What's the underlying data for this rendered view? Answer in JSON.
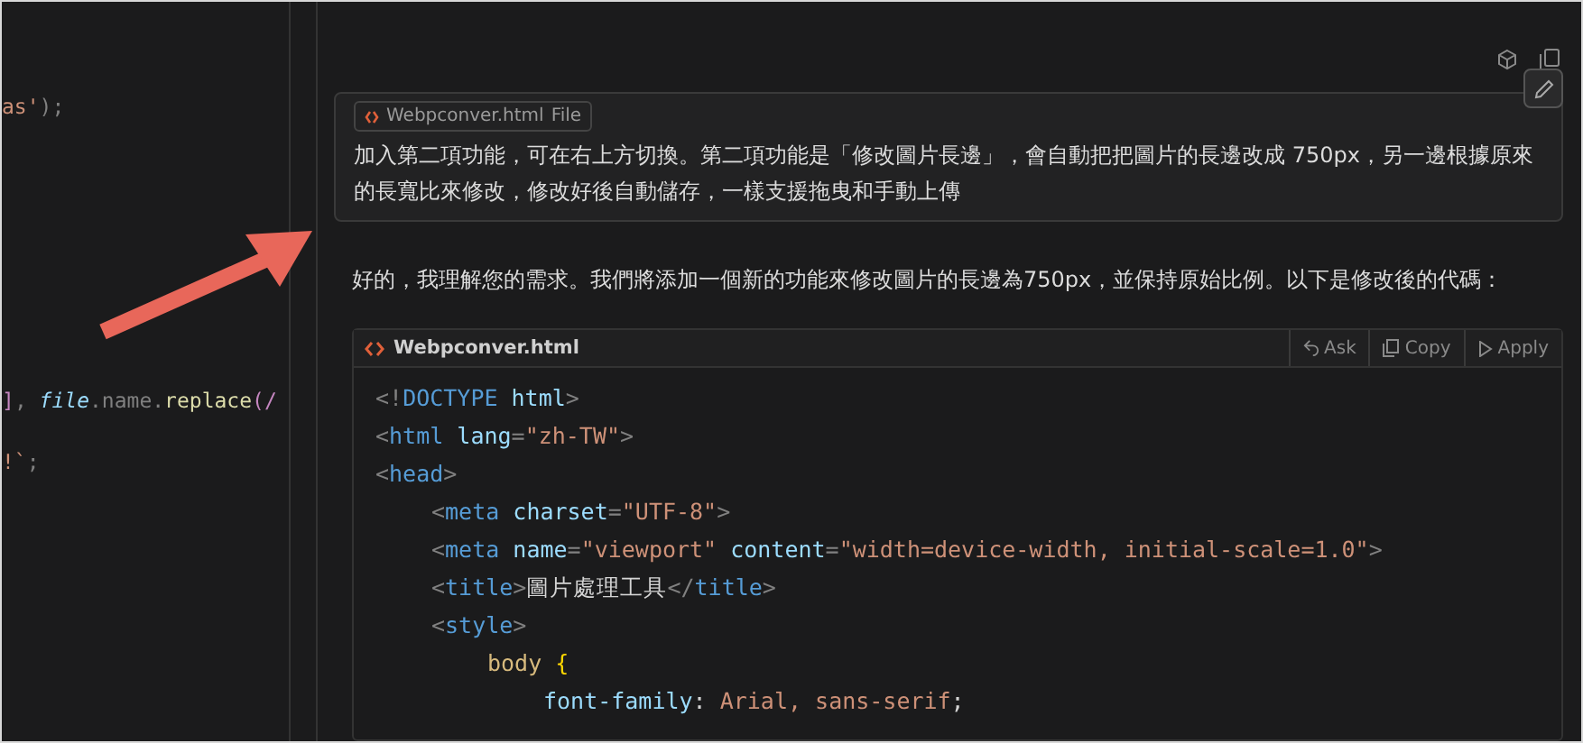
{
  "editor": {
    "lines": [
      {
        "segments": [
          {
            "kind": "string",
            "text": "as'"
          },
          {
            "kind": "punct",
            "text": ");"
          }
        ]
      },
      {
        "segments": [
          {
            "kind": "keyword",
            "text": "]"
          },
          {
            "kind": "punct",
            "text": ", "
          },
          {
            "kind": "italic",
            "text": "file"
          },
          {
            "kind": "punct",
            "text": ".name."
          },
          {
            "kind": "fn",
            "text": "replace"
          },
          {
            "kind": "keyword",
            "text": "(/"
          }
        ]
      },
      {
        "segments": [
          {
            "kind": "string",
            "text": "!`"
          },
          {
            "kind": "punct",
            "text": ";"
          }
        ]
      }
    ]
  },
  "chat": {
    "user_message": {
      "attachment": {
        "name": "Webpconver.html",
        "type": "File"
      },
      "text": "加入第二項功能，可在右上方切換。第二項功能是「修改圖片長邊」，會自動把把圖片的長邊改成 750px，另一邊根據原來的長寬比來修改，修改好後自動儲存，一樣支援拖曳和手動上傳"
    },
    "reply_text": "好的，我理解您的需求。我們將添加一個新的功能來修改圖片的長邊為750px，並保持原始比例。以下是修改後的代碼：",
    "code_block": {
      "filename": "Webpconver.html",
      "actions": [
        {
          "kind": "ask",
          "label": "Ask"
        },
        {
          "kind": "copy",
          "label": "Copy"
        },
        {
          "kind": "apply",
          "label": "Apply"
        }
      ],
      "lines": [
        {
          "segments": [
            {
              "kind": "punct",
              "text": "<!"
            },
            {
              "kind": "tag",
              "text": "DOCTYPE"
            },
            {
              "kind": "attr",
              "text": " html"
            },
            {
              "kind": "punct",
              "text": ">"
            }
          ]
        },
        {
          "segments": [
            {
              "kind": "punct",
              "text": "<"
            },
            {
              "kind": "tag",
              "text": "html"
            },
            {
              "kind": "attr",
              "text": " lang"
            },
            {
              "kind": "punct",
              "text": "="
            },
            {
              "kind": "string",
              "text": "\"zh-TW\""
            },
            {
              "kind": "punct",
              "text": ">"
            }
          ]
        },
        {
          "segments": [
            {
              "kind": "punct",
              "text": "<"
            },
            {
              "kind": "tag",
              "text": "head"
            },
            {
              "kind": "punct",
              "text": ">"
            }
          ],
          "children": [
            {
              "segments": [
                {
                  "kind": "punct",
                  "text": "<"
                },
                {
                  "kind": "tag",
                  "text": "meta"
                },
                {
                  "kind": "attr",
                  "text": " charset"
                },
                {
                  "kind": "punct",
                  "text": "="
                },
                {
                  "kind": "string",
                  "text": "\"UTF-8\""
                },
                {
                  "kind": "punct",
                  "text": ">"
                }
              ]
            },
            {
              "segments": [
                {
                  "kind": "punct",
                  "text": "<"
                },
                {
                  "kind": "tag",
                  "text": "meta"
                },
                {
                  "kind": "attr",
                  "text": " name"
                },
                {
                  "kind": "punct",
                  "text": "="
                },
                {
                  "kind": "string",
                  "text": "\"viewport\""
                },
                {
                  "kind": "attr",
                  "text": " content"
                },
                {
                  "kind": "punct",
                  "text": "="
                },
                {
                  "kind": "string",
                  "text": "\"width=device-width, initial-scale=1.0\""
                },
                {
                  "kind": "punct",
                  "text": ">"
                }
              ]
            },
            {
              "segments": [
                {
                  "kind": "punct",
                  "text": "<"
                },
                {
                  "kind": "tag",
                  "text": "title"
                },
                {
                  "kind": "punct",
                  "text": ">"
                },
                {
                  "kind": "text",
                  "text": "圖片處理工具"
                },
                {
                  "kind": "punct",
                  "text": "</"
                },
                {
                  "kind": "tag",
                  "text": "title"
                },
                {
                  "kind": "punct",
                  "text": ">"
                }
              ]
            },
            {
              "segments": [
                {
                  "kind": "punct",
                  "text": "<"
                },
                {
                  "kind": "tag",
                  "text": "style"
                },
                {
                  "kind": "punct",
                  "text": ">"
                }
              ],
              "children": [
                {
                  "segments": [
                    {
                      "kind": "selector",
                      "text": "body"
                    },
                    {
                      "kind": "brace",
                      "text": " {"
                    }
                  ],
                  "children": [
                    {
                      "segments": [
                        {
                          "kind": "attr",
                          "text": "font-family"
                        },
                        {
                          "kind": "text",
                          "text": ": "
                        },
                        {
                          "kind": "string",
                          "text": "Arial, sans-serif"
                        },
                        {
                          "kind": "text",
                          "text": ";"
                        }
                      ]
                    }
                  ]
                }
              ]
            }
          ]
        }
      ]
    }
  }
}
